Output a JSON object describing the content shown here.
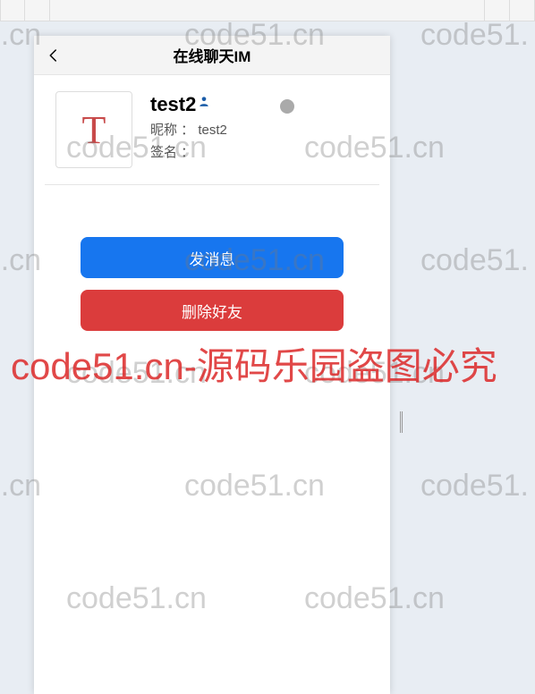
{
  "header": {
    "title": "在线聊天IM"
  },
  "profile": {
    "avatar_letter": "T",
    "username": "test2",
    "nickname_label": "昵称 ：",
    "nickname_value": "test2",
    "signature_label": "签名 ："
  },
  "actions": {
    "send_message": "发消息",
    "delete_friend": "删除好友"
  },
  "watermark": {
    "wm_light": "code51.cn",
    "wm_partial_left": "e51.cn",
    "wm_partial_right": "code51.",
    "wm_red": "code51.cn-源码乐园盗图必究"
  }
}
